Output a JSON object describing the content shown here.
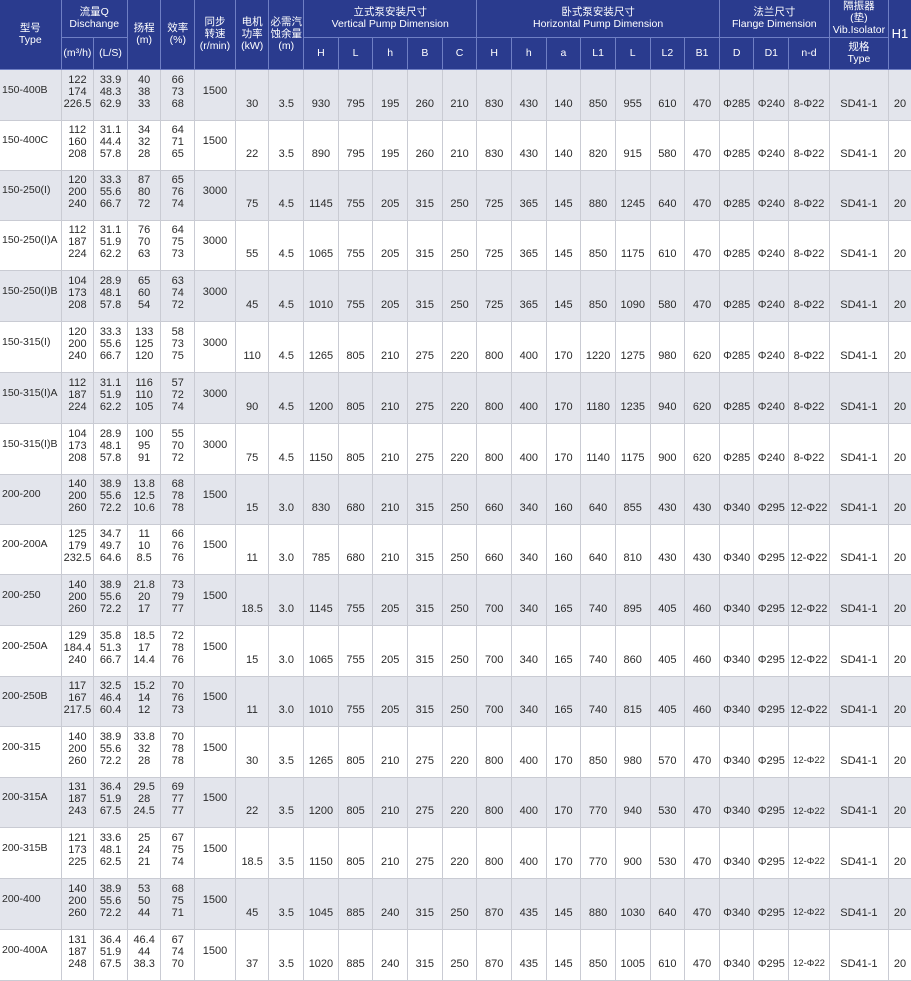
{
  "header": {
    "type": [
      "型号",
      "Type"
    ],
    "flow": [
      "流量Q",
      "Dischange"
    ],
    "flow_m3h": "(m³/h)",
    "flow_ls": "(L/S)",
    "head": [
      "扬程",
      "(m)"
    ],
    "eff": [
      "效率",
      "(%)"
    ],
    "speed": [
      "同步",
      "转速",
      "(r/min)"
    ],
    "power": [
      "电机",
      "功率",
      "(kW)"
    ],
    "npsh": [
      "必需汽",
      "蚀余量",
      "(m)"
    ],
    "vertical": [
      "立式泵安装尺寸",
      "Vertical Pump Dimension"
    ],
    "horizontal": [
      "卧式泵安装尺寸",
      "Horizontal Pump Dimension"
    ],
    "flange": [
      "法兰尺寸",
      "Flange Dimension"
    ],
    "isolator": [
      "隔振器",
      "(垫)",
      "Vib.Isolator"
    ],
    "isolator_spec": [
      "规格",
      "Type"
    ],
    "h1": "H1",
    "vertical_cols": [
      "H",
      "L",
      "h",
      "B",
      "C"
    ],
    "horizontal_cols": [
      "H",
      "h",
      "a",
      "L1",
      "L",
      "L2",
      "B1"
    ],
    "flange_cols": [
      "D",
      "D1",
      "n-d"
    ]
  },
  "rows": [
    {
      "type": "150-400B",
      "q1": [
        "122",
        "174",
        "226.5"
      ],
      "q2": [
        "33.9",
        "48.3",
        "62.9"
      ],
      "head": [
        "40",
        "38",
        "33"
      ],
      "eff": [
        "66",
        "73",
        "68"
      ],
      "speed": "1500",
      "power": "30",
      "npsh": "3.5",
      "v": [
        "930",
        "795",
        "195",
        "260",
        "210"
      ],
      "h": [
        "830",
        "430",
        "140",
        "850",
        "955",
        "610",
        "470"
      ],
      "f": [
        "Φ285",
        "Φ240",
        "8-Φ22"
      ],
      "iso": "SD41-1",
      "h1": "20"
    },
    {
      "type": "150-400C",
      "q1": [
        "112",
        "160",
        "208"
      ],
      "q2": [
        "31.1",
        "44.4",
        "57.8"
      ],
      "head": [
        "34",
        "32",
        "28"
      ],
      "eff": [
        "64",
        "71",
        "65"
      ],
      "speed": "1500",
      "power": "22",
      "npsh": "3.5",
      "v": [
        "890",
        "795",
        "195",
        "260",
        "210"
      ],
      "h": [
        "830",
        "430",
        "140",
        "820",
        "915",
        "580",
        "470"
      ],
      "f": [
        "Φ285",
        "Φ240",
        "8-Φ22"
      ],
      "iso": "SD41-1",
      "h1": "20"
    },
    {
      "type": "150-250(I)",
      "q1": [
        "120",
        "200",
        "240"
      ],
      "q2": [
        "33.3",
        "55.6",
        "66.7"
      ],
      "head": [
        "87",
        "80",
        "72"
      ],
      "eff": [
        "65",
        "76",
        "74"
      ],
      "speed": "3000",
      "power": "75",
      "npsh": "4.5",
      "v": [
        "1145",
        "755",
        "205",
        "315",
        "250"
      ],
      "h": [
        "725",
        "365",
        "145",
        "880",
        "1245",
        "640",
        "470"
      ],
      "f": [
        "Φ285",
        "Φ240",
        "8-Φ22"
      ],
      "iso": "SD41-1",
      "h1": "20"
    },
    {
      "type": "150-250(I)A",
      "q1": [
        "112",
        "187",
        "224"
      ],
      "q2": [
        "31.1",
        "51.9",
        "62.2"
      ],
      "head": [
        "76",
        "70",
        "63"
      ],
      "eff": [
        "64",
        "75",
        "73"
      ],
      "speed": "3000",
      "power": "55",
      "npsh": "4.5",
      "v": [
        "1065",
        "755",
        "205",
        "315",
        "250"
      ],
      "h": [
        "725",
        "365",
        "145",
        "850",
        "1175",
        "610",
        "470"
      ],
      "f": [
        "Φ285",
        "Φ240",
        "8-Φ22"
      ],
      "iso": "SD41-1",
      "h1": "20"
    },
    {
      "type": "150-250(I)B",
      "q1": [
        "104",
        "173",
        "208"
      ],
      "q2": [
        "28.9",
        "48.1",
        "57.8"
      ],
      "head": [
        "65",
        "60",
        "54"
      ],
      "eff": [
        "63",
        "74",
        "72"
      ],
      "speed": "3000",
      "power": "45",
      "npsh": "4.5",
      "v": [
        "1010",
        "755",
        "205",
        "315",
        "250"
      ],
      "h": [
        "725",
        "365",
        "145",
        "850",
        "1090",
        "580",
        "470"
      ],
      "f": [
        "Φ285",
        "Φ240",
        "8-Φ22"
      ],
      "iso": "SD41-1",
      "h1": "20"
    },
    {
      "type": "150-315(I)",
      "q1": [
        "120",
        "200",
        "240"
      ],
      "q2": [
        "33.3",
        "55.6",
        "66.7"
      ],
      "head": [
        "133",
        "125",
        "120"
      ],
      "eff": [
        "58",
        "73",
        "75"
      ],
      "speed": "3000",
      "power": "110",
      "npsh": "4.5",
      "v": [
        "1265",
        "805",
        "210",
        "275",
        "220"
      ],
      "h": [
        "800",
        "400",
        "170",
        "1220",
        "1275",
        "980",
        "620"
      ],
      "f": [
        "Φ285",
        "Φ240",
        "8-Φ22"
      ],
      "iso": "SD41-1",
      "h1": "20"
    },
    {
      "type": "150-315(I)A",
      "q1": [
        "112",
        "187",
        "224"
      ],
      "q2": [
        "31.1",
        "51.9",
        "62.2"
      ],
      "head": [
        "116",
        "110",
        "105"
      ],
      "eff": [
        "57",
        "72",
        "74"
      ],
      "speed": "3000",
      "power": "90",
      "npsh": "4.5",
      "v": [
        "1200",
        "805",
        "210",
        "275",
        "220"
      ],
      "h": [
        "800",
        "400",
        "170",
        "1180",
        "1235",
        "940",
        "620"
      ],
      "f": [
        "Φ285",
        "Φ240",
        "8-Φ22"
      ],
      "iso": "SD41-1",
      "h1": "20"
    },
    {
      "type": "150-315(I)B",
      "q1": [
        "104",
        "173",
        "208"
      ],
      "q2": [
        "28.9",
        "48.1",
        "57.8"
      ],
      "head": [
        "100",
        "95",
        "91"
      ],
      "eff": [
        "55",
        "70",
        "72"
      ],
      "speed": "3000",
      "power": "75",
      "npsh": "4.5",
      "v": [
        "1150",
        "805",
        "210",
        "275",
        "220"
      ],
      "h": [
        "800",
        "400",
        "170",
        "1140",
        "1175",
        "900",
        "620"
      ],
      "f": [
        "Φ285",
        "Φ240",
        "8-Φ22"
      ],
      "iso": "SD41-1",
      "h1": "20"
    },
    {
      "type": "200-200",
      "q1": [
        "140",
        "200",
        "260"
      ],
      "q2": [
        "38.9",
        "55.6",
        "72.2"
      ],
      "head": [
        "13.8",
        "12.5",
        "10.6"
      ],
      "eff": [
        "68",
        "78",
        "78"
      ],
      "speed": "1500",
      "power": "15",
      "npsh": "3.0",
      "v": [
        "830",
        "680",
        "210",
        "315",
        "250"
      ],
      "h": [
        "660",
        "340",
        "160",
        "640",
        "855",
        "430",
        "430"
      ],
      "f": [
        "Φ340",
        "Φ295",
        "12-Φ22"
      ],
      "iso": "SD41-1",
      "h1": "20"
    },
    {
      "type": "200-200A",
      "q1": [
        "125",
        "179",
        "232.5"
      ],
      "q2": [
        "34.7",
        "49.7",
        "64.6"
      ],
      "head": [
        "11",
        "10",
        "8.5"
      ],
      "eff": [
        "66",
        "76",
        "76"
      ],
      "speed": "1500",
      "power": "11",
      "npsh": "3.0",
      "v": [
        "785",
        "680",
        "210",
        "315",
        "250"
      ],
      "h": [
        "660",
        "340",
        "160",
        "640",
        "810",
        "430",
        "430"
      ],
      "f": [
        "Φ340",
        "Φ295",
        "12-Φ22"
      ],
      "iso": "SD41-1",
      "h1": "20"
    },
    {
      "type": "200-250",
      "q1": [
        "140",
        "200",
        "260"
      ],
      "q2": [
        "38.9",
        "55.6",
        "72.2"
      ],
      "head": [
        "21.8",
        "20",
        "17"
      ],
      "eff": [
        "73",
        "79",
        "77"
      ],
      "speed": "1500",
      "power": "18.5",
      "npsh": "3.0",
      "v": [
        "1145",
        "755",
        "205",
        "315",
        "250"
      ],
      "h": [
        "700",
        "340",
        "165",
        "740",
        "895",
        "405",
        "460"
      ],
      "f": [
        "Φ340",
        "Φ295",
        "12-Φ22"
      ],
      "iso": "SD41-1",
      "h1": "20"
    },
    {
      "type": "200-250A",
      "q1": [
        "129",
        "184.4",
        "240"
      ],
      "q2": [
        "35.8",
        "51.3",
        "66.7"
      ],
      "head": [
        "18.5",
        "17",
        "14.4"
      ],
      "eff": [
        "72",
        "78",
        "76"
      ],
      "speed": "1500",
      "power": "15",
      "npsh": "3.0",
      "v": [
        "1065",
        "755",
        "205",
        "315",
        "250"
      ],
      "h": [
        "700",
        "340",
        "165",
        "740",
        "860",
        "405",
        "460"
      ],
      "f": [
        "Φ340",
        "Φ295",
        "12-Φ22"
      ],
      "iso": "SD41-1",
      "h1": "20"
    },
    {
      "type": "200-250B",
      "q1": [
        "117",
        "167",
        "217.5"
      ],
      "q2": [
        "32.5",
        "46.4",
        "60.4"
      ],
      "head": [
        "15.2",
        "14",
        "12"
      ],
      "eff": [
        "70",
        "76",
        "73"
      ],
      "speed": "1500",
      "power": "11",
      "npsh": "3.0",
      "v": [
        "1010",
        "755",
        "205",
        "315",
        "250"
      ],
      "h": [
        "700",
        "340",
        "165",
        "740",
        "815",
        "405",
        "460"
      ],
      "f": [
        "Φ340",
        "Φ295",
        "12-Φ22"
      ],
      "iso": "SD41-1",
      "h1": "20"
    },
    {
      "type": "200-315",
      "q1": [
        "140",
        "200",
        "260"
      ],
      "q2": [
        "38.9",
        "55.6",
        "72.2"
      ],
      "head": [
        "33.8",
        "32",
        "28"
      ],
      "eff": [
        "70",
        "78",
        "78"
      ],
      "speed": "1500",
      "power": "30",
      "npsh": "3.5",
      "v": [
        "1265",
        "805",
        "210",
        "275",
        "220"
      ],
      "h": [
        "800",
        "400",
        "170",
        "850",
        "980",
        "570",
        "470"
      ],
      "f": [
        "Φ340",
        "Φ295",
        "12-Φ22"
      ],
      "iso": "SD41-1",
      "h1": "20"
    },
    {
      "type": "200-315A",
      "q1": [
        "131",
        "187",
        "243"
      ],
      "q2": [
        "36.4",
        "51.9",
        "67.5"
      ],
      "head": [
        "29.5",
        "28",
        "24.5"
      ],
      "eff": [
        "69",
        "77",
        "77"
      ],
      "speed": "1500",
      "power": "22",
      "npsh": "3.5",
      "v": [
        "1200",
        "805",
        "210",
        "275",
        "220"
      ],
      "h": [
        "800",
        "400",
        "170",
        "770",
        "940",
        "530",
        "470"
      ],
      "f": [
        "Φ340",
        "Φ295",
        "12-Φ22"
      ],
      "iso": "SD41-1",
      "h1": "20"
    },
    {
      "type": "200-315B",
      "q1": [
        "121",
        "173",
        "225"
      ],
      "q2": [
        "33.6",
        "48.1",
        "62.5"
      ],
      "head": [
        "25",
        "24",
        "21"
      ],
      "eff": [
        "67",
        "75",
        "74"
      ],
      "speed": "1500",
      "power": "18.5",
      "npsh": "3.5",
      "v": [
        "1150",
        "805",
        "210",
        "275",
        "220"
      ],
      "h": [
        "800",
        "400",
        "170",
        "770",
        "900",
        "530",
        "470"
      ],
      "f": [
        "Φ340",
        "Φ295",
        "12-Φ22"
      ],
      "iso": "SD41-1",
      "h1": "20"
    },
    {
      "type": "200-400",
      "q1": [
        "140",
        "200",
        "260"
      ],
      "q2": [
        "38.9",
        "55.6",
        "72.2"
      ],
      "head": [
        "53",
        "50",
        "44"
      ],
      "eff": [
        "68",
        "75",
        "71"
      ],
      "speed": "1500",
      "power": "45",
      "npsh": "3.5",
      "v": [
        "1045",
        "885",
        "240",
        "315",
        "250"
      ],
      "h": [
        "870",
        "435",
        "145",
        "880",
        "1030",
        "640",
        "470"
      ],
      "f": [
        "Φ340",
        "Φ295",
        "12-Φ22"
      ],
      "iso": "SD41-1",
      "h1": "20"
    },
    {
      "type": "200-400A",
      "q1": [
        "131",
        "187",
        "248"
      ],
      "q2": [
        "36.4",
        "51.9",
        "67.5"
      ],
      "head": [
        "46.4",
        "44",
        "38.3"
      ],
      "eff": [
        "67",
        "74",
        "70"
      ],
      "speed": "1500",
      "power": "37",
      "npsh": "3.5",
      "v": [
        "1020",
        "885",
        "240",
        "315",
        "250"
      ],
      "h": [
        "870",
        "435",
        "145",
        "850",
        "1005",
        "610",
        "470"
      ],
      "f": [
        "Φ340",
        "Φ295",
        "12-Φ22"
      ],
      "iso": "SD41-1",
      "h1": "20"
    }
  ]
}
